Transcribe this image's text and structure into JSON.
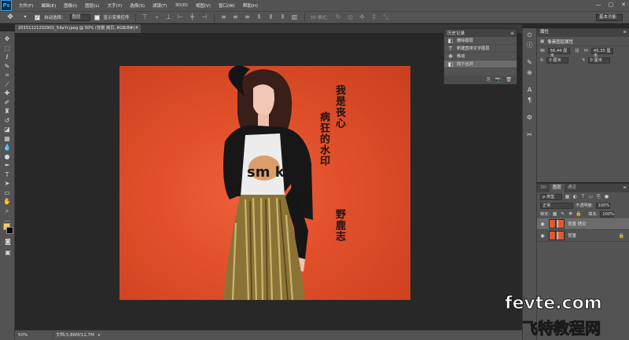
{
  "app": {
    "logo": "Ps"
  },
  "menu": [
    "文件(F)",
    "编辑(E)",
    "图像(I)",
    "图层(L)",
    "文字(Y)",
    "选择(S)",
    "滤镜(T)",
    "3D(D)",
    "视图(V)",
    "窗口(W)",
    "帮助(H)"
  ],
  "window_controls": [
    "—",
    "▢",
    "✕"
  ],
  "options": {
    "auto_select_label": "自动选择：",
    "auto_select_value": "图层",
    "show_transform_label": "显示变换控件",
    "mode_3d_label": "3D 模式：",
    "workspace": "基本功能"
  },
  "document": {
    "tab_title": "20151121202901_54aYr.jpeg @ 50% (背景 拷贝, RGB/8#) *",
    "tab_close": "×",
    "zoom": "50%",
    "doc_size": "文档:5.86M/11.7M"
  },
  "watermark": {
    "col1": "我是丧心",
    "col2": "病狂的水印",
    "col3": "野鹿志"
  },
  "photo_text": {
    "shirt": "sm k"
  },
  "history": {
    "title": "历史记录",
    "menu_icon": "≡",
    "items": [
      {
        "icon": "◧",
        "label": "删除图层"
      },
      {
        "icon": "T",
        "label": "新建直排文字图层"
      },
      {
        "icon": "✥",
        "label": "移动"
      },
      {
        "icon": "◧",
        "label": "向下合并"
      }
    ],
    "footer_icons": [
      "⎘",
      "📷",
      "🗑"
    ]
  },
  "properties": {
    "title": "属性",
    "subtitle": "像素图层属性",
    "w_label": "W:",
    "w_value": "56.44 厘米",
    "h_label": "H:",
    "h_value": "45.35 厘米",
    "x_label": "X:",
    "x_value": "0 厘米",
    "y_label": "Y:",
    "y_value": "0 厘米"
  },
  "layers": {
    "tabs": [
      "3D",
      "图层",
      "通道"
    ],
    "kind_label": "ρ 类型",
    "blend_mode": "正常",
    "opacity_label": "不透明度:",
    "opacity_value": "100%",
    "lock_label": "锁定:",
    "fill_label": "填充:",
    "fill_value": "100%",
    "items": [
      {
        "name": "背景 拷贝",
        "selected": true
      },
      {
        "name": "背景",
        "selected": false
      }
    ]
  },
  "site_watermark": {
    "line1": "fevte.com",
    "line2": "飞特教程网"
  },
  "icons": {
    "toolbar": [
      "move-icon",
      "marquee-icon",
      "lasso-icon",
      "quick-select-icon",
      "crop-icon",
      "eyedropper-icon",
      "healing-icon",
      "brush-icon",
      "stamp-icon",
      "history-brush-icon",
      "eraser-icon",
      "gradient-icon",
      "blur-icon",
      "dodge-icon",
      "pen-icon",
      "type-icon",
      "path-select-icon",
      "shape-icon",
      "hand-icon",
      "zoom-icon"
    ]
  }
}
